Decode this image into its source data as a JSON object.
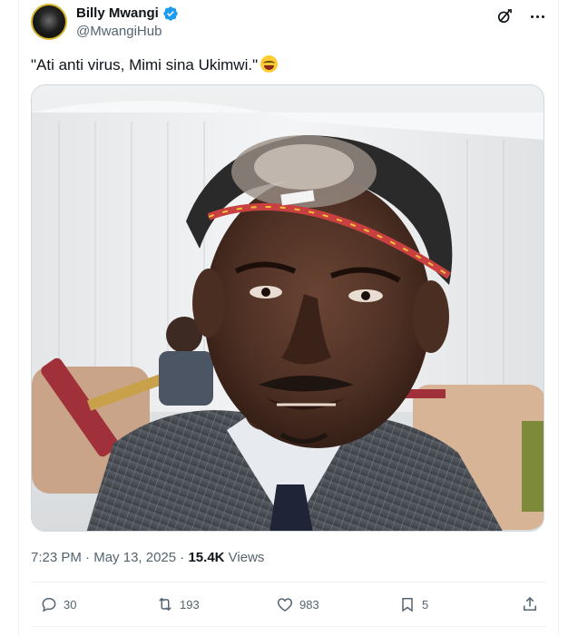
{
  "author": {
    "name": "Billy Mwangi",
    "handle": "@MwangiHub",
    "verified": true
  },
  "tweet": {
    "text": "\"Ati anti virus, Mimi sina Ukimwi.\"",
    "emoji": "face-with-tears-of-joy"
  },
  "meta": {
    "time": "7:23 PM",
    "separator": "·",
    "date": "May 13, 2025",
    "views_count": "15.4K",
    "views_label": "Views"
  },
  "actions": {
    "replies": "30",
    "reposts": "193",
    "likes": "983",
    "bookmarks": "5"
  },
  "colors": {
    "accent": "#1d9bf0",
    "text_primary": "#0f1419",
    "text_secondary": "#536471",
    "border": "#eff3f4"
  },
  "icons": [
    "grok-icon",
    "more-icon",
    "verified-icon",
    "reply-icon",
    "repost-icon",
    "like-icon",
    "bookmark-icon",
    "share-icon"
  ]
}
